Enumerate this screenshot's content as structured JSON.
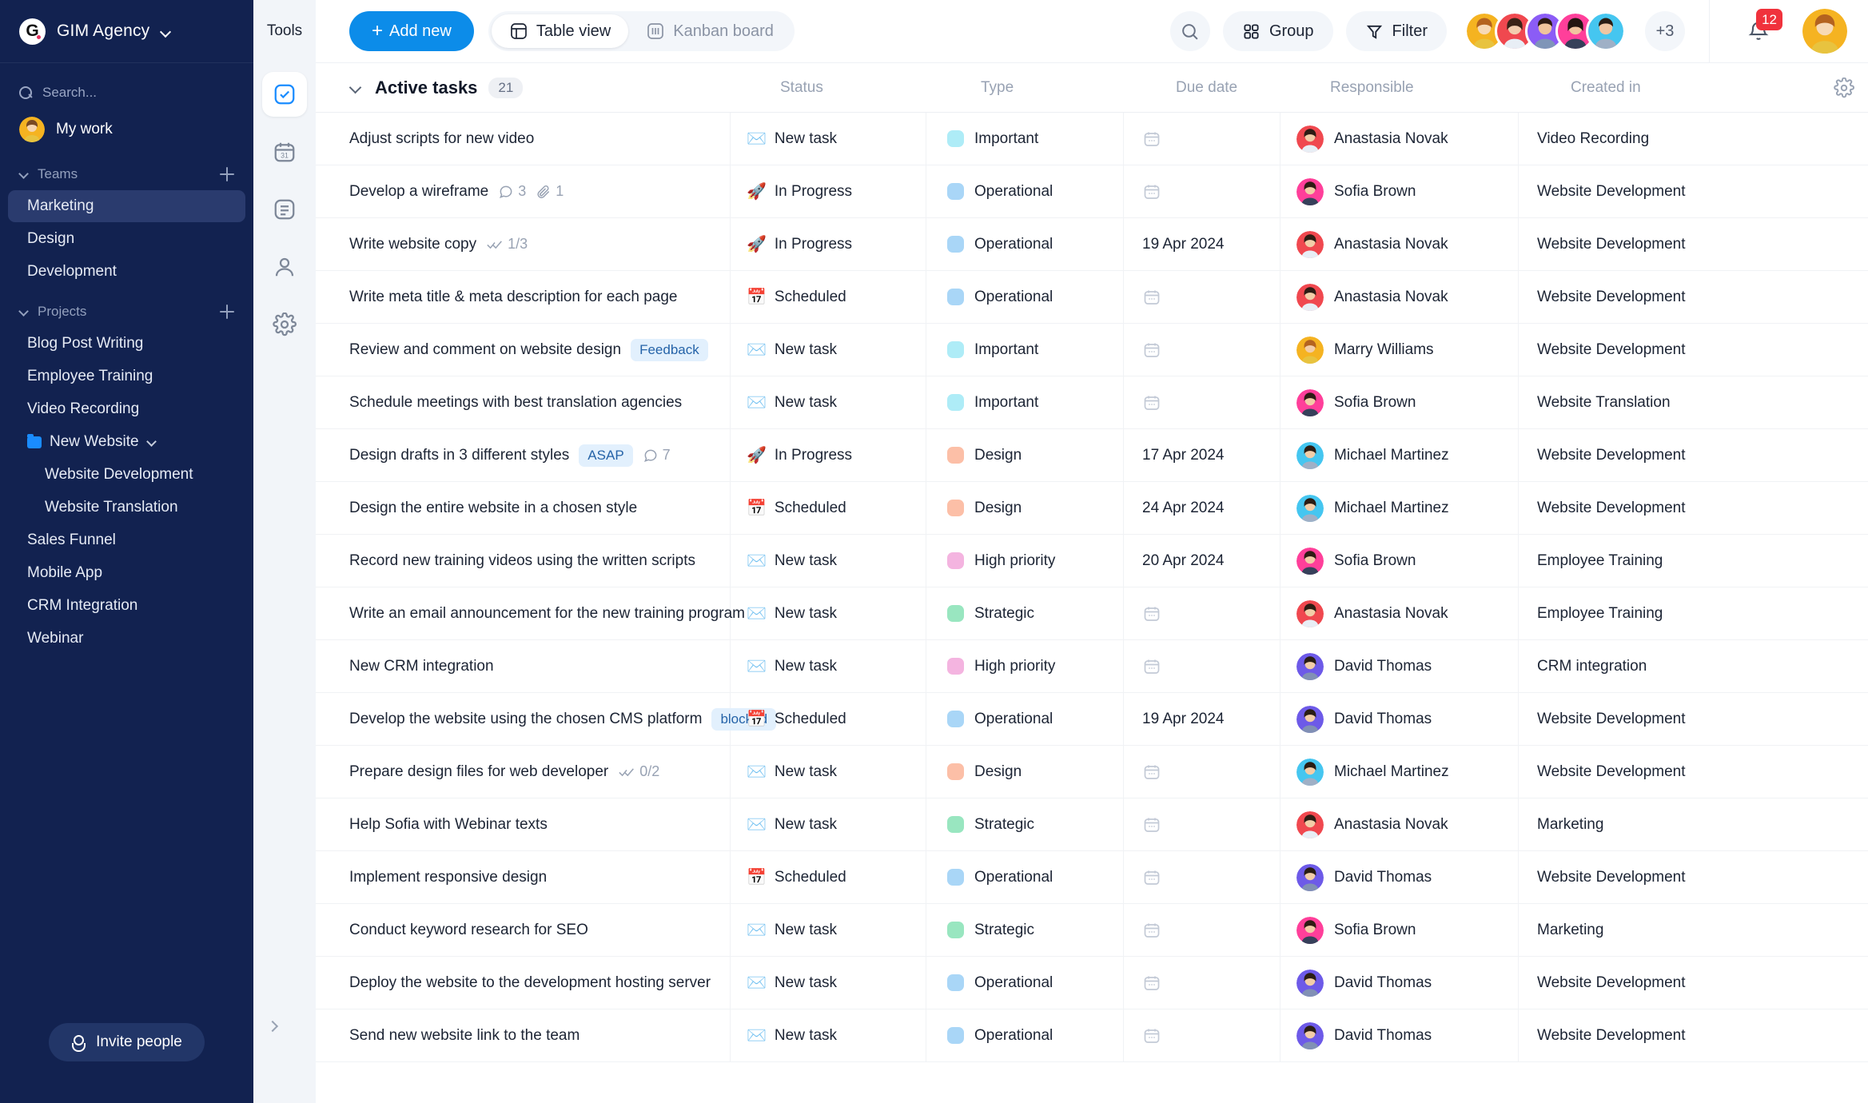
{
  "sidebar": {
    "workspace": {
      "name": "GIM Agency",
      "logo_letter": "G",
      "chevron": "chevron-down-icon"
    },
    "search": {
      "placeholder": "Search...",
      "icon": "search-icon"
    },
    "my_work": {
      "label": "My work"
    },
    "teams": {
      "title": "Teams",
      "add_label": "+",
      "items": [
        {
          "label": "Marketing",
          "active": true
        },
        {
          "label": "Design",
          "active": false
        },
        {
          "label": "Development",
          "active": false
        }
      ]
    },
    "projects": {
      "title": "Projects",
      "add_label": "+",
      "items": [
        {
          "label": "Blog Post Writing",
          "type": "project"
        },
        {
          "label": "Employee Training",
          "type": "project"
        },
        {
          "label": "Video Recording",
          "type": "project"
        },
        {
          "label": "New Website",
          "type": "folder"
        },
        {
          "label": "Website Development",
          "type": "sub"
        },
        {
          "label": "Website Translation",
          "type": "sub"
        },
        {
          "label": "Sales Funnel",
          "type": "project"
        },
        {
          "label": "Mobile App",
          "type": "project"
        },
        {
          "label": "CRM Integration",
          "type": "project"
        },
        {
          "label": "Webinar",
          "type": "project"
        }
      ]
    },
    "invite": {
      "label": "Invite people",
      "icon": "person-add-icon"
    },
    "collapse": {
      "icon": "chevron-right-icon"
    }
  },
  "tools_rail": {
    "label": "Tools",
    "items": [
      {
        "name": "tasks-icon",
        "active": true
      },
      {
        "name": "calendar-icon",
        "active": false
      },
      {
        "name": "notes-icon",
        "active": false
      },
      {
        "name": "contacts-icon",
        "active": false
      },
      {
        "name": "settings-icon",
        "active": false
      }
    ]
  },
  "topbar": {
    "add_new": "Add new",
    "views": [
      {
        "label": "Table view",
        "icon": "table-icon",
        "active": true
      },
      {
        "label": "Kanban board",
        "icon": "kanban-icon",
        "active": false
      }
    ],
    "search_icon": "search-icon",
    "group": {
      "label": "Group",
      "icon": "grid-icon"
    },
    "filter": {
      "label": "Filter",
      "icon": "funnel-icon"
    },
    "avatar_colors": [
      "#f5b321",
      "#f0484f",
      "#8b5cf6",
      "#ff3f9a",
      "#45c6f0"
    ],
    "more_members": "+3",
    "notifications": {
      "count": "12",
      "icon": "bell-icon"
    },
    "current_user_color": "#f5b321"
  },
  "table": {
    "group": {
      "title": "Active tasks",
      "count": "21",
      "collapse_icon": "chevron-down-icon"
    },
    "settings_icon": "gear-icon",
    "columns": [
      "",
      "Status",
      "Type",
      "Due date",
      "Responsible",
      "Created in"
    ],
    "type_colors": {
      "Important": "#aeecf7",
      "Operational": "#a9d6f7",
      "Design": "#fcbfa7",
      "High priority": "#f4b4e0",
      "Strategic": "#99e6c0"
    },
    "status_emoji": {
      "New task": "✉️",
      "In Progress": "🚀",
      "Scheduled": "📅"
    },
    "rows": [
      {
        "task": "Adjust scripts for new video",
        "tag": "",
        "comments": "",
        "attachments": "",
        "subtasks": "",
        "status": "New task",
        "type": "Important",
        "due": "",
        "responsible": "Anastasia Novak",
        "avatar": "#f0484f",
        "created": "Video Recording"
      },
      {
        "task": "Develop a wireframe",
        "tag": "",
        "comments": "3",
        "attachments": "1",
        "subtasks": "",
        "status": "In Progress",
        "type": "Operational",
        "due": "",
        "responsible": "Sofia Brown",
        "avatar": "#ff3f9a",
        "created": "Website Development"
      },
      {
        "task": "Write website copy",
        "tag": "",
        "comments": "",
        "attachments": "",
        "subtasks": "1/3",
        "status": "In Progress",
        "type": "Operational",
        "due": "19 Apr 2024",
        "responsible": "Anastasia Novak",
        "avatar": "#f0484f",
        "created": "Website Development"
      },
      {
        "task": "Write meta title & meta description for each page",
        "tag": "",
        "comments": "",
        "attachments": "",
        "subtasks": "",
        "status": "Scheduled",
        "type": "Operational",
        "due": "",
        "responsible": "Anastasia Novak",
        "avatar": "#f0484f",
        "created": "Website Development"
      },
      {
        "task": "Review and comment on website design",
        "tag": "Feedback",
        "comments": "",
        "attachments": "",
        "subtasks": "",
        "status": "New task",
        "type": "Important",
        "due": "",
        "responsible": "Marry Williams",
        "avatar": "#f5b321",
        "created": "Website Development"
      },
      {
        "task": "Schedule meetings with best translation agencies",
        "tag": "",
        "comments": "",
        "attachments": "",
        "subtasks": "",
        "status": "New task",
        "type": "Important",
        "due": "",
        "responsible": "Sofia Brown",
        "avatar": "#ff3f9a",
        "created": "Website Translation"
      },
      {
        "task": "Design drafts in 3 different styles",
        "tag": "ASAP",
        "comments": "7",
        "attachments": "",
        "subtasks": "",
        "status": "In Progress",
        "type": "Design",
        "due": "17 Apr 2024",
        "responsible": "Michael Martinez",
        "avatar": "#45c6f0",
        "created": "Website Development"
      },
      {
        "task": "Design the entire website in a chosen style",
        "tag": "",
        "comments": "",
        "attachments": "",
        "subtasks": "",
        "status": "Scheduled",
        "type": "Design",
        "due": "24 Apr 2024",
        "responsible": "Michael Martinez",
        "avatar": "#45c6f0",
        "created": "Website Development"
      },
      {
        "task": "Record new training videos using the written scripts",
        "tag": "",
        "comments": "",
        "attachments": "",
        "subtasks": "",
        "status": "New task",
        "type": "High priority",
        "due": "20 Apr 2024",
        "responsible": "Sofia Brown",
        "avatar": "#ff3f9a",
        "created": "Employee Training"
      },
      {
        "task": "Write an email announcement for the new training program",
        "tag": "",
        "comments": "",
        "attachments": "",
        "subtasks": "",
        "status": "New task",
        "type": "Strategic",
        "due": "",
        "responsible": "Anastasia Novak",
        "avatar": "#f0484f",
        "created": "Employee Training"
      },
      {
        "task": "New CRM integration",
        "tag": "",
        "comments": "",
        "attachments": "",
        "subtasks": "",
        "status": "New task",
        "type": "High priority",
        "due": "",
        "responsible": "David Thomas",
        "avatar": "#6d5ae8",
        "created": "CRM integration"
      },
      {
        "task": "Develop the website using the chosen CMS platform",
        "tag": "blocked",
        "comments": "",
        "attachments": "",
        "subtasks": "",
        "status": "Scheduled",
        "type": "Operational",
        "due": "19 Apr 2024",
        "responsible": "David Thomas",
        "avatar": "#6d5ae8",
        "created": "Website Development"
      },
      {
        "task": "Prepare design files for web developer",
        "tag": "",
        "comments": "",
        "attachments": "",
        "subtasks": "0/2",
        "status": "New task",
        "type": "Design",
        "due": "",
        "responsible": "Michael Martinez",
        "avatar": "#45c6f0",
        "created": "Website Development"
      },
      {
        "task": "Help Sofia with Webinar texts",
        "tag": "",
        "comments": "",
        "attachments": "",
        "subtasks": "",
        "status": "New task",
        "type": "Strategic",
        "due": "",
        "responsible": "Anastasia Novak",
        "avatar": "#f0484f",
        "created": "Marketing"
      },
      {
        "task": "Implement responsive design",
        "tag": "",
        "comments": "",
        "attachments": "",
        "subtasks": "",
        "status": "Scheduled",
        "type": "Operational",
        "due": "",
        "responsible": "David Thomas",
        "avatar": "#6d5ae8",
        "created": "Website Development"
      },
      {
        "task": "Conduct keyword research for SEO",
        "tag": "",
        "comments": "",
        "attachments": "",
        "subtasks": "",
        "status": "New task",
        "type": "Strategic",
        "due": "",
        "responsible": "Sofia Brown",
        "avatar": "#ff3f9a",
        "created": "Marketing"
      },
      {
        "task": "Deploy the website to the development hosting server",
        "tag": "",
        "comments": "",
        "attachments": "",
        "subtasks": "",
        "status": "New task",
        "type": "Operational",
        "due": "",
        "responsible": "David Thomas",
        "avatar": "#6d5ae8",
        "created": "Website Development"
      },
      {
        "task": "Send new website link to the team",
        "tag": "",
        "comments": "",
        "attachments": "",
        "subtasks": "",
        "status": "New task",
        "type": "Operational",
        "due": "",
        "responsible": "David Thomas",
        "avatar": "#6d5ae8",
        "created": "Website Development"
      }
    ]
  }
}
